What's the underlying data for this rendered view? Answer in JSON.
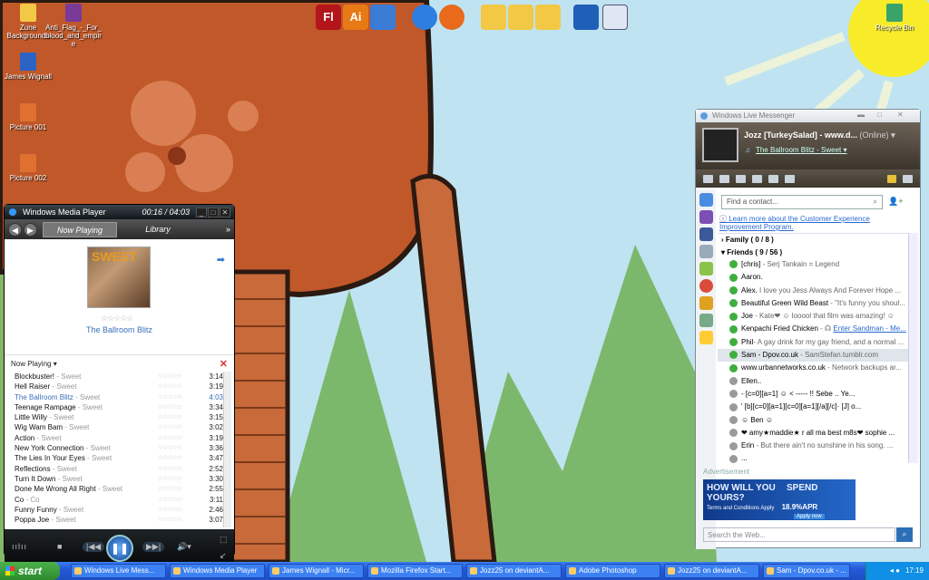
{
  "desktop": {
    "icons": [
      {
        "label": "Zune Backgrounds",
        "icon": "folder-icon",
        "color": "#f3c845"
      },
      {
        "label": "Anti_Flag_-_For_blood_and_empire",
        "icon": "archive-icon",
        "color": "#7a3a9a"
      },
      {
        "label": "James Wignall",
        "icon": "word-document-icon",
        "color": "#2b62c4"
      },
      {
        "label": "Picture 001",
        "icon": "picture-icon",
        "color": "#e07030"
      },
      {
        "label": "Picture 002",
        "icon": "picture-icon",
        "color": "#e07030"
      },
      {
        "label": "Recycle Bin",
        "icon": "recycle-bin-icon",
        "color": "#3aa36a"
      }
    ],
    "quicklaunch": [
      {
        "label": "Fl",
        "icon": "flash-icon",
        "color": "#b3151b"
      },
      {
        "label": "Ai",
        "icon": "illustrator-icon",
        "color": "#e87a16"
      },
      {
        "label": "",
        "icon": "feather-icon",
        "color": "#3a7bd5"
      },
      {
        "label": "",
        "icon": "internet-explorer-icon",
        "color": "#2d7ee0"
      },
      {
        "label": "",
        "icon": "firefox-icon",
        "color": "#e86a1a"
      },
      {
        "label": "",
        "icon": "folder-icon",
        "color": "#f3c845"
      },
      {
        "label": "",
        "icon": "cd-folder-icon",
        "color": "#f3c845"
      },
      {
        "label": "",
        "icon": "picture-folder-icon",
        "color": "#f3c845"
      },
      {
        "label": "",
        "icon": "monitor-icon",
        "color": "#1f5fb8"
      },
      {
        "label": "",
        "icon": "checklist-icon",
        "color": "#dfe7f2"
      }
    ]
  },
  "wmp": {
    "title": "Windows Media Player",
    "time": "00:16 / 04:03",
    "tabs": [
      "Now Playing",
      "Library"
    ],
    "album_art_text": "SWEET",
    "album_title": "The Ballroom Blitz",
    "list_label": "Now Playing",
    "tracks": [
      {
        "name": "Blockbuster!",
        "artist": " - Sweet",
        "dur": "3:14"
      },
      {
        "name": "Hell Raiser",
        "artist": " - Sweet",
        "dur": "3:19"
      },
      {
        "name": "The Ballroom Blitz",
        "artist": " - Sweet",
        "dur": "4:03"
      },
      {
        "name": "Teenage Rampage",
        "artist": " - Sweet",
        "dur": "3:34"
      },
      {
        "name": "Little Willy",
        "artist": " - Sweet",
        "dur": "3:15"
      },
      {
        "name": "Wig Wam Bam",
        "artist": " - Sweet",
        "dur": "3:02"
      },
      {
        "name": "Action",
        "artist": " - Sweet",
        "dur": "3:19"
      },
      {
        "name": "New York Connection",
        "artist": " - Sweet",
        "dur": "3:36"
      },
      {
        "name": "The Lies In Your Eyes",
        "artist": " - Sweet",
        "dur": "3:47"
      },
      {
        "name": "Reflections",
        "artist": " - Sweet",
        "dur": "2:52"
      },
      {
        "name": "Turn It Down",
        "artist": " - Sweet",
        "dur": "3:30"
      },
      {
        "name": "Done Me Wrong All Right",
        "artist": " - Sweet",
        "dur": "2:55"
      },
      {
        "name": "Co",
        "artist": " - Co",
        "dur": "3:11"
      },
      {
        "name": "Funny Funny",
        "artist": " - Sweet",
        "dur": "2:46"
      },
      {
        "name": "Poppa Joe",
        "artist": " - Sweet",
        "dur": "3:07"
      }
    ],
    "current_index": 2
  },
  "messenger": {
    "title": "Windows Live Messenger",
    "user": "Jozz [TurkeySalad] - www.d...",
    "status": "(Online)",
    "psm": "The Ballroom Blitz - Sweet",
    "search_placeholder": "Find a contact...",
    "info_text": "Learn more about the Customer Experience Improvement Program.",
    "groups": [
      {
        "name": "Family ( 0 / 8 )"
      },
      {
        "name": "Friends ( 9 / 56 )"
      }
    ],
    "contacts": [
      {
        "name": "[chris]",
        "msg": " - Serj Tankain = Legend",
        "online": true
      },
      {
        "name": "Aaron.",
        "msg": "",
        "online": true
      },
      {
        "name": "Alex.",
        "msg": "  I love you Jess Always And Forever Hope ...",
        "online": true
      },
      {
        "name": "Beautiful Green Wild Beast",
        "msg": " - \"It's funny you shoul...",
        "online": true
      },
      {
        "name": "Joe",
        "msg": " - Kate❤ ☺  looool that film was amazing! ☺",
        "online": true
      },
      {
        "name": "Kenpachi Fried Chicken",
        "msg": " - ☊ ",
        "link": "Enter Sandman - Me...",
        "online": true
      },
      {
        "name": "Phil",
        "msg": "- A gay drink for my gay friend, and a normal ...",
        "online": true
      },
      {
        "name": "Sam - Dpov.co.uk",
        "msg": " - SamStefan.tumblr.com",
        "online": true,
        "selected": true
      },
      {
        "name": "www.urbannetworks.co.uk",
        "msg": " - Network backups ar...",
        "online": true
      },
      {
        "name": "Ellen..",
        "msg": "",
        "online": false
      },
      {
        "name": "-            [c=0][a=1] ☺ < ----- !!  Sebe  ..  Ye...",
        "msg": "",
        "online": false
      },
      {
        "name": "'            [b][c=0][a=1][c=0][a=1][/a][/c]·  [J] o...",
        "msg": "",
        "online": false
      },
      {
        "name": "☺ Ben ☺",
        "msg": "",
        "online": false
      },
      {
        "name": "❤ amy★maddie★ r all ma best m8s❤ sophie ...",
        "msg": "",
        "online": false
      },
      {
        "name": "Erin",
        "msg": " - But there ain't no sunshine in his song.  ...",
        "online": false
      },
      {
        "name": "...",
        "msg": "",
        "online": false
      }
    ],
    "ad_label": "Advertisement",
    "banner_line1": "HOW WILL YOU",
    "banner_line2": "SPEND YOURS?",
    "banner_small": "Terms and Conditions Apply",
    "banner_apr": "18.9%APR",
    "banner_cta": "Apply now",
    "web_placeholder": "Search the Web..."
  },
  "taskbar": {
    "start": "start",
    "items": [
      "Windows Live Mess...",
      "Windows Media Player",
      "James Wignall - Micr...",
      "Mozilla Firefox Start...",
      "Jozz25 on deviantA...",
      "Adobe Photoshop",
      "Jozz25 on deviantA...",
      "Sam - Dpov.co.uk - ..."
    ],
    "clock": "17:19"
  }
}
